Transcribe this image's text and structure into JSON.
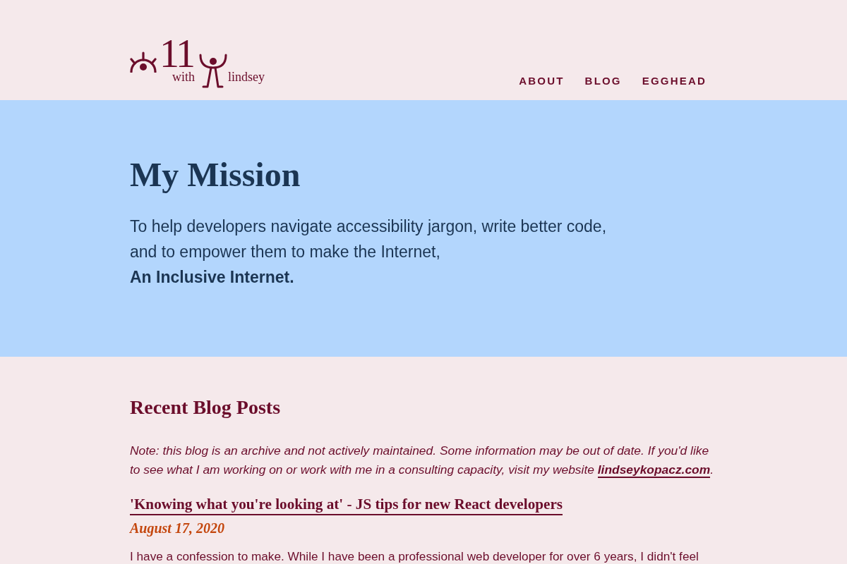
{
  "header": {
    "logo": {
      "numerals": "11",
      "with": "with",
      "name": "lindsey"
    },
    "nav": [
      {
        "label": "ABOUT"
      },
      {
        "label": "BLOG"
      },
      {
        "label": "EGGHEAD"
      }
    ]
  },
  "hero": {
    "title": "My Mission",
    "lines": [
      "To help developers navigate accessibility jargon, write better code,",
      "and to empower them to make the Internet,",
      "**An Inclusive Internet.**"
    ]
  },
  "recent_posts": {
    "heading": "Recent Blog Posts",
    "note": {
      "text": "Note: this blog is an archive and not actively maintained. Some information may be out of date. If you'd like to see what I am working on or work with me in a consulting capacity, visit my website",
      "link": "lindseykopacz.com",
      "after": "."
    },
    "posts": [
      {
        "title": "'Knowing what you're looking at' - JS tips for new React developers",
        "date": "August 17, 2020",
        "excerpt": "I have a confession to make. While I have been a professional web developer for over 6 years, I didn't feel"
      }
    ]
  }
}
